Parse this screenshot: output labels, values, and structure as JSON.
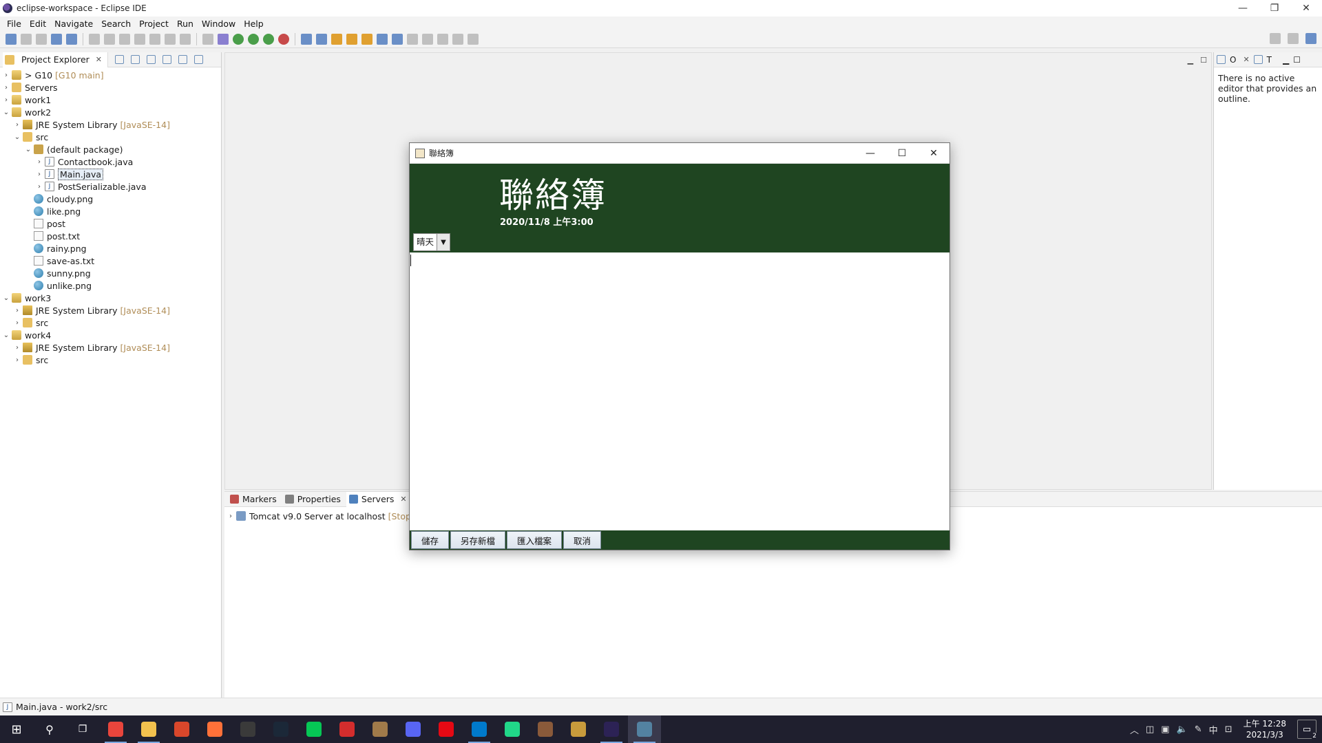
{
  "window": {
    "title": "eclipse-workspace - Eclipse IDE",
    "controls": {
      "minimize": "—",
      "restore": "❐",
      "close": "✕"
    }
  },
  "menu": [
    "File",
    "Edit",
    "Navigate",
    "Search",
    "Project",
    "Run",
    "Window",
    "Help"
  ],
  "project_explorer": {
    "tab_label": "Project Explorer",
    "close": "✕",
    "tree": [
      {
        "level": 0,
        "twisty": "›",
        "icon": "project",
        "label": "> G10",
        "decor": "[G10 main]"
      },
      {
        "level": 0,
        "twisty": "›",
        "icon": "folder",
        "label": "Servers",
        "decor": ""
      },
      {
        "level": 0,
        "twisty": "›",
        "icon": "project",
        "label": "work1",
        "decor": ""
      },
      {
        "level": 0,
        "twisty": "⌄",
        "icon": "project",
        "label": "work2",
        "decor": ""
      },
      {
        "level": 1,
        "twisty": "›",
        "icon": "lib",
        "label": "JRE System Library",
        "decor": "[JavaSE-14]"
      },
      {
        "level": 1,
        "twisty": "⌄",
        "icon": "folder",
        "label": "src",
        "decor": ""
      },
      {
        "level": 2,
        "twisty": "⌄",
        "icon": "pkg",
        "label": "(default package)",
        "decor": ""
      },
      {
        "level": 3,
        "twisty": "›",
        "icon": "java",
        "label": "Contactbook.java",
        "decor": ""
      },
      {
        "level": 3,
        "twisty": "›",
        "icon": "java",
        "label": "Main.java",
        "decor": "",
        "selected": true
      },
      {
        "level": 3,
        "twisty": "›",
        "icon": "java",
        "label": "PostSerializable.java",
        "decor": ""
      },
      {
        "level": 2,
        "twisty": "",
        "icon": "img",
        "label": "cloudy.png",
        "decor": ""
      },
      {
        "level": 2,
        "twisty": "",
        "icon": "img",
        "label": "like.png",
        "decor": ""
      },
      {
        "level": 2,
        "twisty": "",
        "icon": "txt",
        "label": "post",
        "decor": ""
      },
      {
        "level": 2,
        "twisty": "",
        "icon": "txt",
        "label": "post.txt",
        "decor": ""
      },
      {
        "level": 2,
        "twisty": "",
        "icon": "img",
        "label": "rainy.png",
        "decor": ""
      },
      {
        "level": 2,
        "twisty": "",
        "icon": "txt",
        "label": "save-as.txt",
        "decor": ""
      },
      {
        "level": 2,
        "twisty": "",
        "icon": "img",
        "label": "sunny.png",
        "decor": ""
      },
      {
        "level": 2,
        "twisty": "",
        "icon": "img",
        "label": "unlike.png",
        "decor": ""
      },
      {
        "level": 0,
        "twisty": "⌄",
        "icon": "project",
        "label": "work3",
        "decor": ""
      },
      {
        "level": 1,
        "twisty": "›",
        "icon": "lib",
        "label": "JRE System Library",
        "decor": "[JavaSE-14]"
      },
      {
        "level": 1,
        "twisty": "›",
        "icon": "folder",
        "label": "src",
        "decor": ""
      },
      {
        "level": 0,
        "twisty": "⌄",
        "icon": "project",
        "label": "work4",
        "decor": ""
      },
      {
        "level": 1,
        "twisty": "›",
        "icon": "lib",
        "label": "JRE System Library",
        "decor": "[JavaSE-14]"
      },
      {
        "level": 1,
        "twisty": "›",
        "icon": "folder",
        "label": "src",
        "decor": ""
      }
    ]
  },
  "outline": {
    "tab_o": "O",
    "tab_t": "T",
    "message": "There is no active editor that provides an outline."
  },
  "bottom": {
    "tabs": [
      {
        "label": "Markers",
        "active": false,
        "icon_color": "#c0504d"
      },
      {
        "label": "Properties",
        "active": false,
        "icon_color": "#7f7f7f"
      },
      {
        "label": "Servers",
        "active": true,
        "icon_color": "#4f81bd"
      }
    ],
    "server_label": "Tomcat v9.0 Server at localhost",
    "server_state": "[Stoppe"
  },
  "status": {
    "text": "Main.java - work2/src"
  },
  "dialog": {
    "caption": "聯絡簿",
    "heading": "聯絡簿",
    "datetime": "2020/11/8  上午3:00",
    "weather_value": "晴天",
    "buttons": [
      "儲存",
      "另存新檔",
      "匯入檔案",
      "取消"
    ],
    "controls": {
      "minimize": "—",
      "maximize": "☐",
      "close": "✕"
    },
    "header_color": "#1f4521"
  },
  "taskbar": {
    "apps": [
      {
        "name": "chrome-icon",
        "color": "#e8453c"
      },
      {
        "name": "file-explorer-icon",
        "color": "#f2c14e"
      },
      {
        "name": "office-icon",
        "color": "#d9472b"
      },
      {
        "name": "firefox-icon",
        "color": "#ff7139"
      },
      {
        "name": "terminal-icon",
        "color": "#3a3a3a"
      },
      {
        "name": "steam-icon",
        "color": "#1b2838"
      },
      {
        "name": "line-icon",
        "color": "#06c755"
      },
      {
        "name": "garena-icon",
        "color": "#d42d2d"
      },
      {
        "name": "game-icon",
        "color": "#a07a4a"
      },
      {
        "name": "discord-icon",
        "color": "#5865f2"
      },
      {
        "name": "netflix-icon",
        "color": "#e50914"
      },
      {
        "name": "vscode-icon",
        "color": "#007acc"
      },
      {
        "name": "pycharm-icon",
        "color": "#21d789"
      },
      {
        "name": "game2-icon",
        "color": "#8a5a3a"
      },
      {
        "name": "league-icon",
        "color": "#c89b3c"
      },
      {
        "name": "eclipse-icon",
        "color": "#2c2255"
      },
      {
        "name": "java-icon",
        "color": "#5382a1"
      }
    ],
    "time": "上午 12:28",
    "date": "2021/3/3",
    "ime": "中",
    "notifications": "2"
  }
}
